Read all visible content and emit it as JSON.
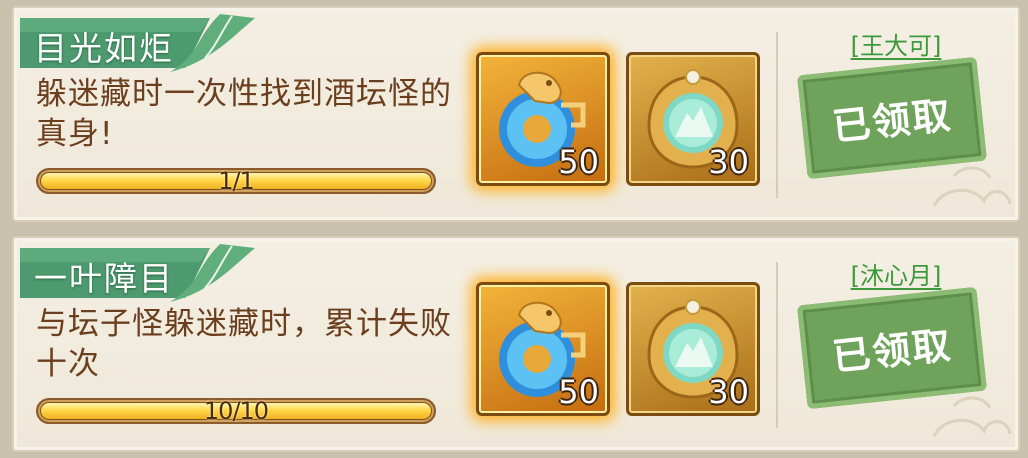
{
  "tasks": [
    {
      "title": "目光如炬",
      "description": "躲迷藏时一次性找到酒坛怪的真身!",
      "progress_text": "1/1",
      "progress_fraction": 1.0,
      "rewards": [
        {
          "icon": "jade-dragon-ring-icon",
          "count": "50",
          "highlighted": true
        },
        {
          "icon": "jade-mountain-amulet-icon",
          "count": "30",
          "highlighted": false
        }
      ],
      "player_name": "[王大可]",
      "status_label": "已领取"
    },
    {
      "title": "一叶障目",
      "description": "与坛子怪躲迷藏时，累计失败十次",
      "progress_text": "10/10",
      "progress_fraction": 1.0,
      "rewards": [
        {
          "icon": "jade-dragon-ring-icon",
          "count": "50",
          "highlighted": true
        },
        {
          "icon": "jade-mountain-amulet-icon",
          "count": "30",
          "highlighted": false
        }
      ],
      "player_name": "[沐心月]",
      "status_label": "已领取"
    }
  ],
  "colors": {
    "title_tab": "#4c9a6e",
    "stamp": "#6fa25a",
    "player_name": "#3c9a3c",
    "description_text": "#6b3e1e"
  }
}
